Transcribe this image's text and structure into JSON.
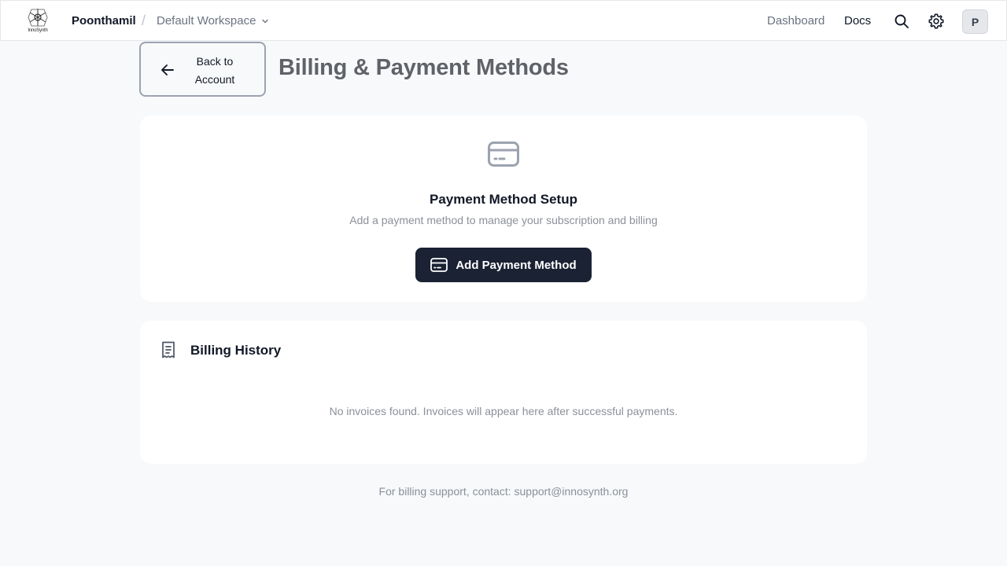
{
  "header": {
    "logo_text": "InnoSynth",
    "brand": "Poonthamil",
    "separator": "/",
    "workspace": "Default Workspace",
    "nav": {
      "dashboard": "Dashboard",
      "docs": "Docs"
    },
    "avatar_initial": "P",
    "icons": [
      "search-icon",
      "gear-icon",
      "chevron-down-icon"
    ]
  },
  "page": {
    "back_label": "Back to Account",
    "title": "Billing & Payment Methods"
  },
  "payment_setup": {
    "title": "Payment Method Setup",
    "subtitle": "Add a payment method to manage your subscription and billing",
    "button_label": "Add Payment Method"
  },
  "billing_history": {
    "title": "Billing History",
    "empty_message": "No invoices found. Invoices will appear here after successful payments."
  },
  "footer": {
    "text": "For billing support, contact: support@innosynth.org"
  },
  "colors": {
    "background": "#f8f9fb",
    "primary_button": "#1a2233",
    "muted_text": "#8b9099",
    "title_text": "#5f6268"
  }
}
